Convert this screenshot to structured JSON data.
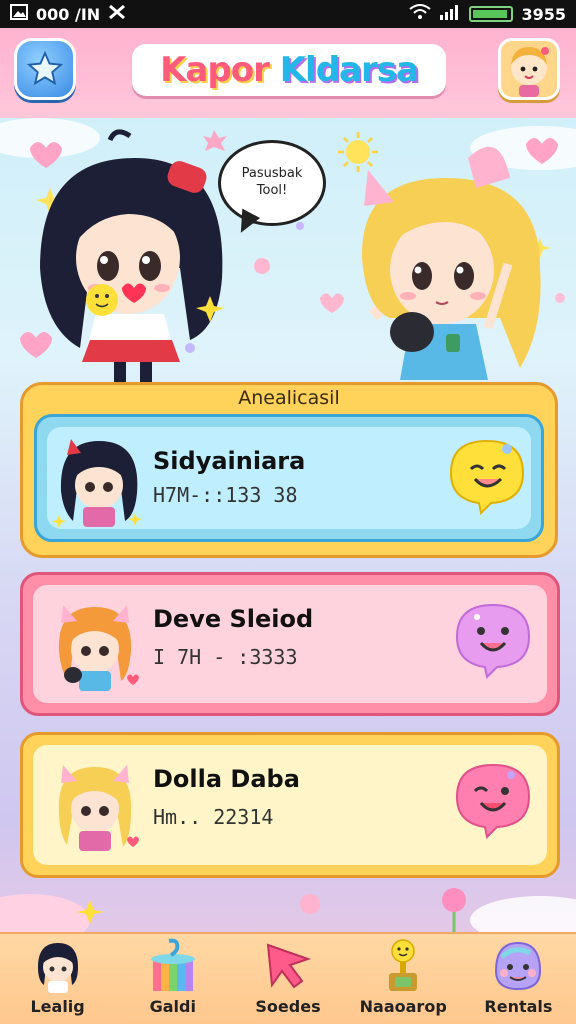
{
  "status_bar": {
    "left_text": "000 /IN",
    "battery_text": "3955"
  },
  "header": {
    "title_part1": "Kapor",
    "title_part2": "Kldarsa"
  },
  "hero": {
    "speech_line1": "Pasusbak",
    "speech_line2": "Tool!"
  },
  "panel": {
    "label": "Anealicasil"
  },
  "cards": [
    {
      "name": "Sidyainiara",
      "meta": "H7M-::133 38"
    },
    {
      "name": "Deve Sleiod",
      "meta": "I 7H - :3333"
    },
    {
      "name": "Dolla Daba",
      "meta": "Hm.. 22314"
    }
  ],
  "nav": [
    {
      "label": "Lealig",
      "icon": "girl-avatar-icon"
    },
    {
      "label": "Galdi",
      "icon": "gift-box-icon"
    },
    {
      "label": "Soedes",
      "icon": "pink-arrow-icon"
    },
    {
      "label": "Naaoarop",
      "icon": "trophy-icon"
    },
    {
      "label": "Rentals",
      "icon": "blob-icon"
    }
  ]
}
